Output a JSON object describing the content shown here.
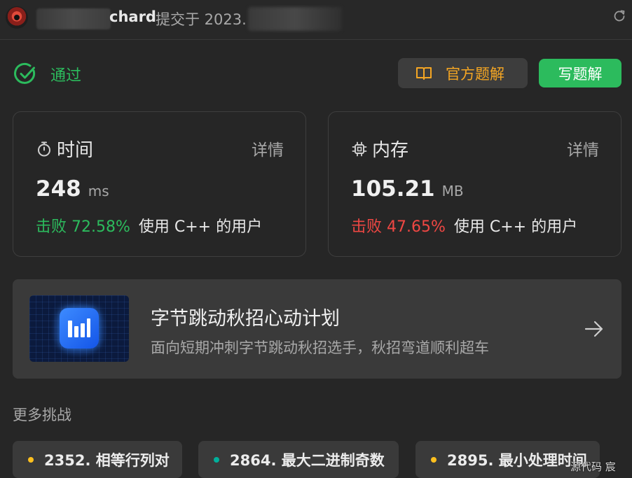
{
  "header": {
    "username": "chard",
    "submitted_text": "提交于 2023."
  },
  "result": {
    "status": "通过",
    "official_solution_label": "官方题解",
    "write_solution_label": "写题解"
  },
  "time_card": {
    "title": "时间",
    "detail_label": "详情",
    "value": "248",
    "unit": "ms",
    "beat_text": "击败 72.58%",
    "beat_suffix": "使用 C++ 的用户"
  },
  "memory_card": {
    "title": "内存",
    "detail_label": "详情",
    "value": "105.21",
    "unit": "MB",
    "beat_text": "击败 47.65%",
    "beat_suffix": "使用 C++ 的用户"
  },
  "promo": {
    "title": "字节跳动秋招心动计划",
    "subtitle": "面向短期冲刺字节跳动秋招选手，秋招弯道顺利超车"
  },
  "more": {
    "title": "更多挑战",
    "items": [
      {
        "label": "2352. 相等行列对",
        "dot_color": "#ffc01e"
      },
      {
        "label": "2864. 最大二进制奇数",
        "dot_color": "#00af9b"
      },
      {
        "label": "2895. 最小处理时间",
        "dot_color": "#ffc01e"
      }
    ]
  },
  "watermark": "源代码  宸",
  "colors": {
    "accepted": "#2cbb5d",
    "official": "#f5a623",
    "beat_good": "#2cbb5d",
    "beat_bad": "#ef4743"
  }
}
